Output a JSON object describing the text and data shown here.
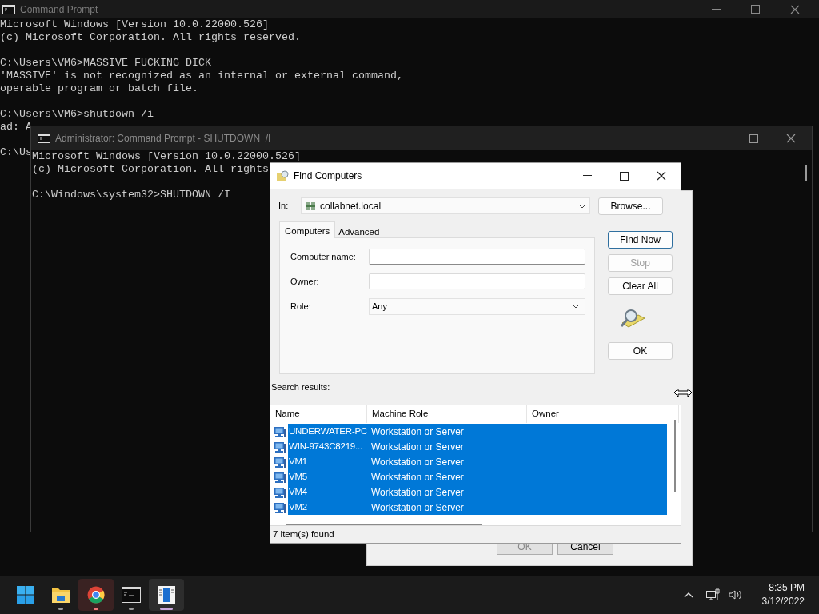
{
  "background_console": {
    "title": "Command Prompt",
    "blocks": [
      [
        "Microsoft Windows [Version 10.0.22000.526]",
        "(c) Microsoft Corporation. All rights reserved."
      ],
      [
        "C:\\Users\\VM6>MASSIVE FUCKING DICK",
        "'MASSIVE' is not recognized as an internal or external command,",
        "operable program or batch file."
      ],
      [
        "C:\\Users\\VM6>shutdown /i",
        "ad: A"
      ],
      [
        "C:\\Us"
      ]
    ]
  },
  "admin_console": {
    "title": "Administrator: Command Prompt - SHUTDOWN  /I",
    "blocks": [
      [
        "Microsoft Windows [Version 10.0.22000.526]",
        "(c) Microsoft Corporation. All rights"
      ],
      [
        "C:\\Windows\\system32>SHUTDOWN /I"
      ]
    ]
  },
  "shutdown_dialog": {
    "buttons": [
      {
        "label": "OK",
        "disabled": true
      },
      {
        "label": "Cancel",
        "disabled": false
      }
    ]
  },
  "find_dialog": {
    "title": "Find Computers",
    "in_label": "In:",
    "location": "collabnet.local",
    "browse_button": "Browse...",
    "tabs": [
      {
        "label": "Computers",
        "selected": true
      },
      {
        "label": "Advanced",
        "selected": false
      }
    ],
    "fields": [
      {
        "kind": "text",
        "label": "Computer name:"
      },
      {
        "kind": "text",
        "label": "Owner:"
      },
      {
        "kind": "select",
        "label": "Role:",
        "value": "Any"
      }
    ],
    "buttons": [
      {
        "label": "Find Now",
        "default": true,
        "disabled": false
      },
      {
        "label": "Stop",
        "default": false,
        "disabled": true
      },
      {
        "label": "Clear All",
        "default": false,
        "disabled": false
      }
    ],
    "ok_button": "OK",
    "results_label": "Search results:",
    "columns": [
      "Name",
      "Machine Role",
      "Owner"
    ],
    "rows": [
      {
        "name": "UNDERWATER-PC",
        "role": "Workstation or Server",
        "selected": true
      },
      {
        "name": "WIN-9743C8219...",
        "role": "Workstation or Server",
        "selected": true
      },
      {
        "name": "VM1",
        "role": "Workstation or Server",
        "selected": true
      },
      {
        "name": "VM5",
        "role": "Workstation or Server",
        "selected": true
      },
      {
        "name": "VM4",
        "role": "Workstation or Server",
        "selected": true
      },
      {
        "name": "VM2",
        "role": "Workstation or Server",
        "selected": true
      }
    ],
    "status": "7 item(s) found"
  },
  "taskbar": {
    "apps": [
      {
        "kind": "start"
      },
      {
        "kind": "folder",
        "open": true,
        "focused": false,
        "attention": false
      },
      {
        "kind": "browser",
        "open": true,
        "focused": false,
        "attention": true
      },
      {
        "kind": "terminal",
        "open": true,
        "focused": false,
        "attention": false
      },
      {
        "kind": "dialog",
        "open": true,
        "focused": true,
        "attention": false
      }
    ],
    "time": "8:35 PM",
    "date": "3/12/2022"
  }
}
